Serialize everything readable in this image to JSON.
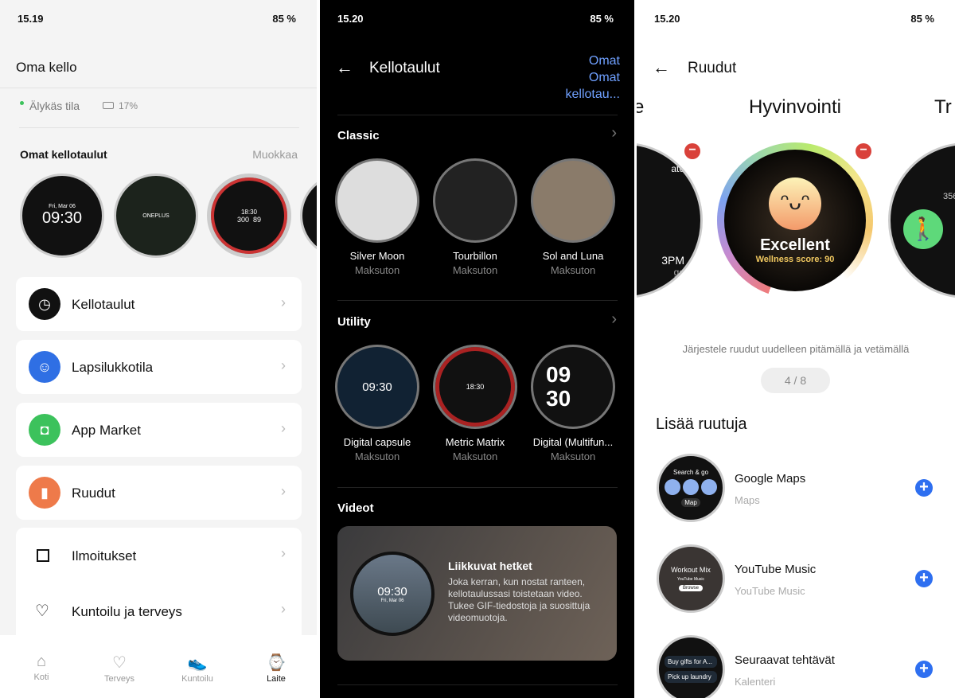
{
  "status": [
    {
      "time": "15.19",
      "battery": "85 %"
    },
    {
      "time": "15.20",
      "battery": "85 %"
    },
    {
      "time": "15.20",
      "battery": "85 %"
    }
  ],
  "p1": {
    "title": "Oma kello",
    "mode": "Älykäs tila",
    "watch_battery": "17%",
    "section": "Omat kellotaulut",
    "edit": "Muokkaa",
    "faces": [
      {
        "date": "Fri, Mar 06",
        "time": "09:30"
      },
      {
        "brand": "ONEPLUS"
      },
      {
        "time": "18:30",
        "left": "300",
        "right": "89"
      }
    ],
    "cards": [
      {
        "label": "Kellotaulut",
        "icon": "clock-icon",
        "color": "#111111"
      },
      {
        "label": "Lapsilukkotila",
        "icon": "child-lock-icon",
        "color": "#2f6fe4"
      },
      {
        "label": "App Market",
        "icon": "shopping-bag-icon",
        "color": "#3cc25c"
      },
      {
        "label": "Ruudut",
        "icon": "tiles-icon",
        "color": "#ee7a4a"
      }
    ],
    "list": [
      {
        "label": "Ilmoitukset",
        "icon": "notification-icon"
      },
      {
        "label": "Kuntoilu ja terveys",
        "icon": "heart-icon"
      }
    ],
    "nav": [
      {
        "label": "Koti",
        "icon": "home-icon"
      },
      {
        "label": "Terveys",
        "icon": "heart-icon"
      },
      {
        "label": "Kuntoilu",
        "icon": "shoe-icon"
      },
      {
        "label": "Laite",
        "icon": "watch-icon",
        "active": true
      }
    ]
  },
  "p2": {
    "title": "Kellotaulut",
    "link": "Omat kellotau...",
    "classic": {
      "title": "Classic",
      "faces": [
        {
          "name": "Silver Moon",
          "price": "Maksuton"
        },
        {
          "name": "Tourbillon",
          "price": "Maksuton"
        },
        {
          "name": "Sol and Luna",
          "price": "Maksuton"
        }
      ]
    },
    "utility": {
      "title": "Utility",
      "faces": [
        {
          "name": "Digital capsule",
          "price": "Maksuton",
          "time": "09:30"
        },
        {
          "name": "Metric Matrix",
          "price": "Maksuton",
          "time": "18:30"
        },
        {
          "name": "Digital (Multifun...",
          "price": "Maksuton",
          "time": "09 30"
        }
      ]
    },
    "videos": {
      "title": "Videot",
      "card_title": "Liikkuvat hetket",
      "card_desc": "Joka kerran, kun nostat ranteen, kellotaulussasi toistetaan video. Tukee GIF-tiedostoja ja suosittuja videomuotoja.",
      "time": "09:30",
      "date": "Fri, Mar 06"
    }
  },
  "p3": {
    "title": "Ruudut",
    "carousel": {
      "left": "e",
      "center": "Hyvinvointi",
      "right": "Tr"
    },
    "tile": {
      "status": "Excellent",
      "score": "Wellness score: 90",
      "left_label": "ate",
      "left_time": "3PM",
      "left_ago": "go",
      "right_num": "356"
    },
    "hint": "Järjestele ruudut uudelleen pitämällä ja vetämällä",
    "pager": "4 / 8",
    "add_title": "Lisää ruutuja",
    "items": [
      {
        "title": "Google Maps",
        "sub": "Maps",
        "preview": "Search & go",
        "btn": "Map"
      },
      {
        "title": "YouTube Music",
        "sub": "YouTube Music",
        "preview": "Workout Mix",
        "btn": "Browse"
      },
      {
        "title": "Seuraavat tehtävät",
        "sub": "Kalenteri",
        "preview": "Buy gifts for A...",
        "btn": "Pick up laundry"
      }
    ]
  }
}
